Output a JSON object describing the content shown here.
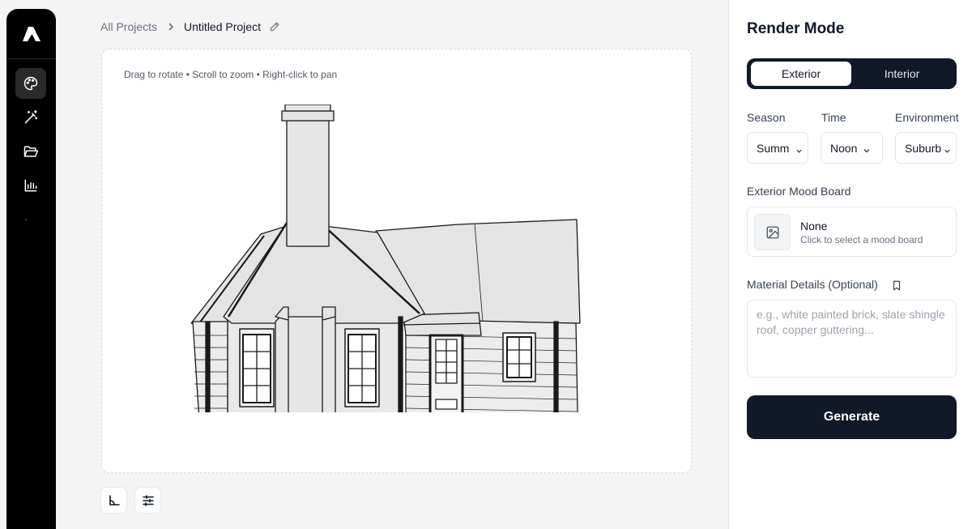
{
  "breadcrumb": {
    "root": "All Projects",
    "current": "Untitled Project"
  },
  "sidebar": {
    "items": [
      {
        "icon": "palette-icon",
        "active": true
      },
      {
        "icon": "magic-wand-icon",
        "active": false
      },
      {
        "icon": "folder-open-icon",
        "active": false
      },
      {
        "icon": "bar-chart-icon",
        "active": false
      }
    ]
  },
  "viewport": {
    "hint": "Drag to rotate • Scroll to zoom • Right-click to pan"
  },
  "tools": [
    {
      "icon": "axes-icon"
    },
    {
      "icon": "sliders-icon"
    }
  ],
  "panel": {
    "title": "Render Mode",
    "modes": {
      "exterior": "Exterior",
      "interior": "Interior",
      "selected": "Exterior"
    },
    "season": {
      "label": "Season",
      "value": "Summ"
    },
    "time": {
      "label": "Time",
      "value": "Noon"
    },
    "environment": {
      "label": "Environment",
      "value": "Suburb"
    },
    "moodboard": {
      "label": "Exterior Mood Board",
      "title": "None",
      "subtitle": "Click to select a mood board"
    },
    "material": {
      "label": "Material Details (Optional)",
      "placeholder": "e.g., white painted brick, slate shingle roof, copper guttering..."
    },
    "generate_label": "Generate"
  },
  "colors": {
    "sidebar_bg": "#000000",
    "primary_dark": "#111827",
    "page_bg": "#f4f4f5"
  }
}
